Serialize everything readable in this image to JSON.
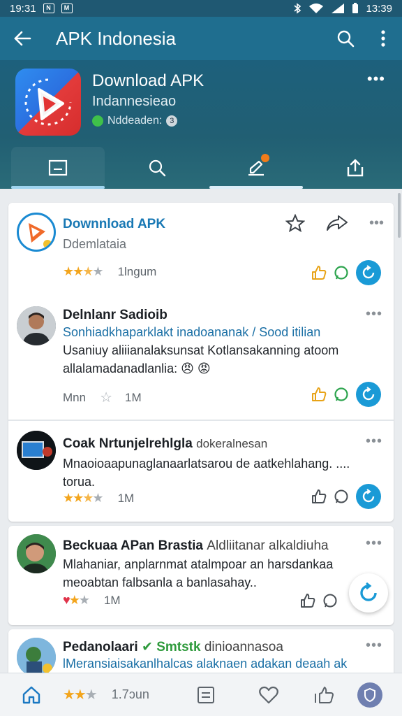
{
  "status_bar": {
    "time_left": "19:31",
    "time_right": "13:39"
  },
  "app_bar": {
    "title": "APK Indonesia"
  },
  "app_header": {
    "title": "Download APK",
    "subtitle": "Indannesieao",
    "meta": "Nddeaden:"
  },
  "posts": [
    {
      "name": "Downnload APK",
      "subtitle": "Ddemlataia",
      "rating_stars": 3,
      "rating_label": "1lngum"
    },
    {
      "name": "Delnlanr Sadioib",
      "link_text": "Sonhiadkhaparklakt inadoananak / Sood itilian",
      "body": "Usaniuy aliiianalaksunsat Kotlansakanning atoom allalamadanadlanlia: 😠 😡",
      "stat_a": "Mnn",
      "stat_b": "1M"
    },
    {
      "name": "Coak Nrtunjelrehlgla",
      "name_extra": "dokeralnesan",
      "body": "Mnaoioaapunaglanaarlatsarou de aatkehlahang. .... torua.",
      "rating_stars": 3,
      "stat": "1M"
    },
    {
      "name": "Beckuaa APan Brastia",
      "name_extra": "Aldliitanar alkaldiuha",
      "body": "Mlahaniar, anplarnmat atalmpoar an harsdankaa meoabtan falbsanla a banlasahay..",
      "stat": "1M"
    },
    {
      "name": "Pedanolaari",
      "name_verified": "Smtstk",
      "name_extra": "dinioannasoa",
      "body": "lMeransiaisakanlhalcas alaknaen adakan deaah ak"
    }
  ],
  "bottom_bar": {
    "rating_stars": 3,
    "count_label": "1.7ɔun"
  },
  "colors": {
    "app_bar": "#1f6e8f",
    "accent_blue": "#1a9ad6",
    "star": "#f3a51d",
    "link": "#1a6fa5",
    "verified": "#2e9a3c"
  }
}
